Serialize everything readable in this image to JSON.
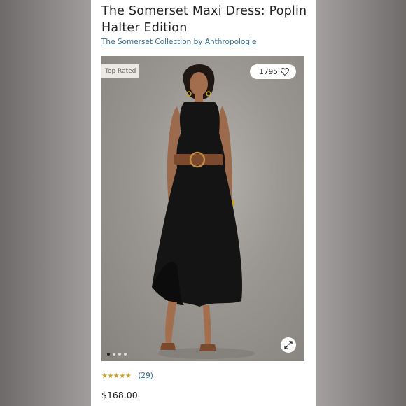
{
  "product": {
    "title": "The Somerset Maxi Dress: Poplin Halter Edition",
    "collection_link": "The Somerset Collection by Anthropologie",
    "badge": "Top Rated",
    "likes": "1795",
    "rating_stars": "★★★★★",
    "rating_value": 4.5,
    "review_count": "(29)",
    "price": "$168.00"
  },
  "gallery": {
    "image_count": 4,
    "active_index": 0
  },
  "colors": {
    "link": "#3a6f8a",
    "star": "#c9a227",
    "dress": "#141414",
    "belt": "#7b4a2e"
  },
  "icons": {
    "like": "heart-icon",
    "expand": "expand-icon"
  }
}
